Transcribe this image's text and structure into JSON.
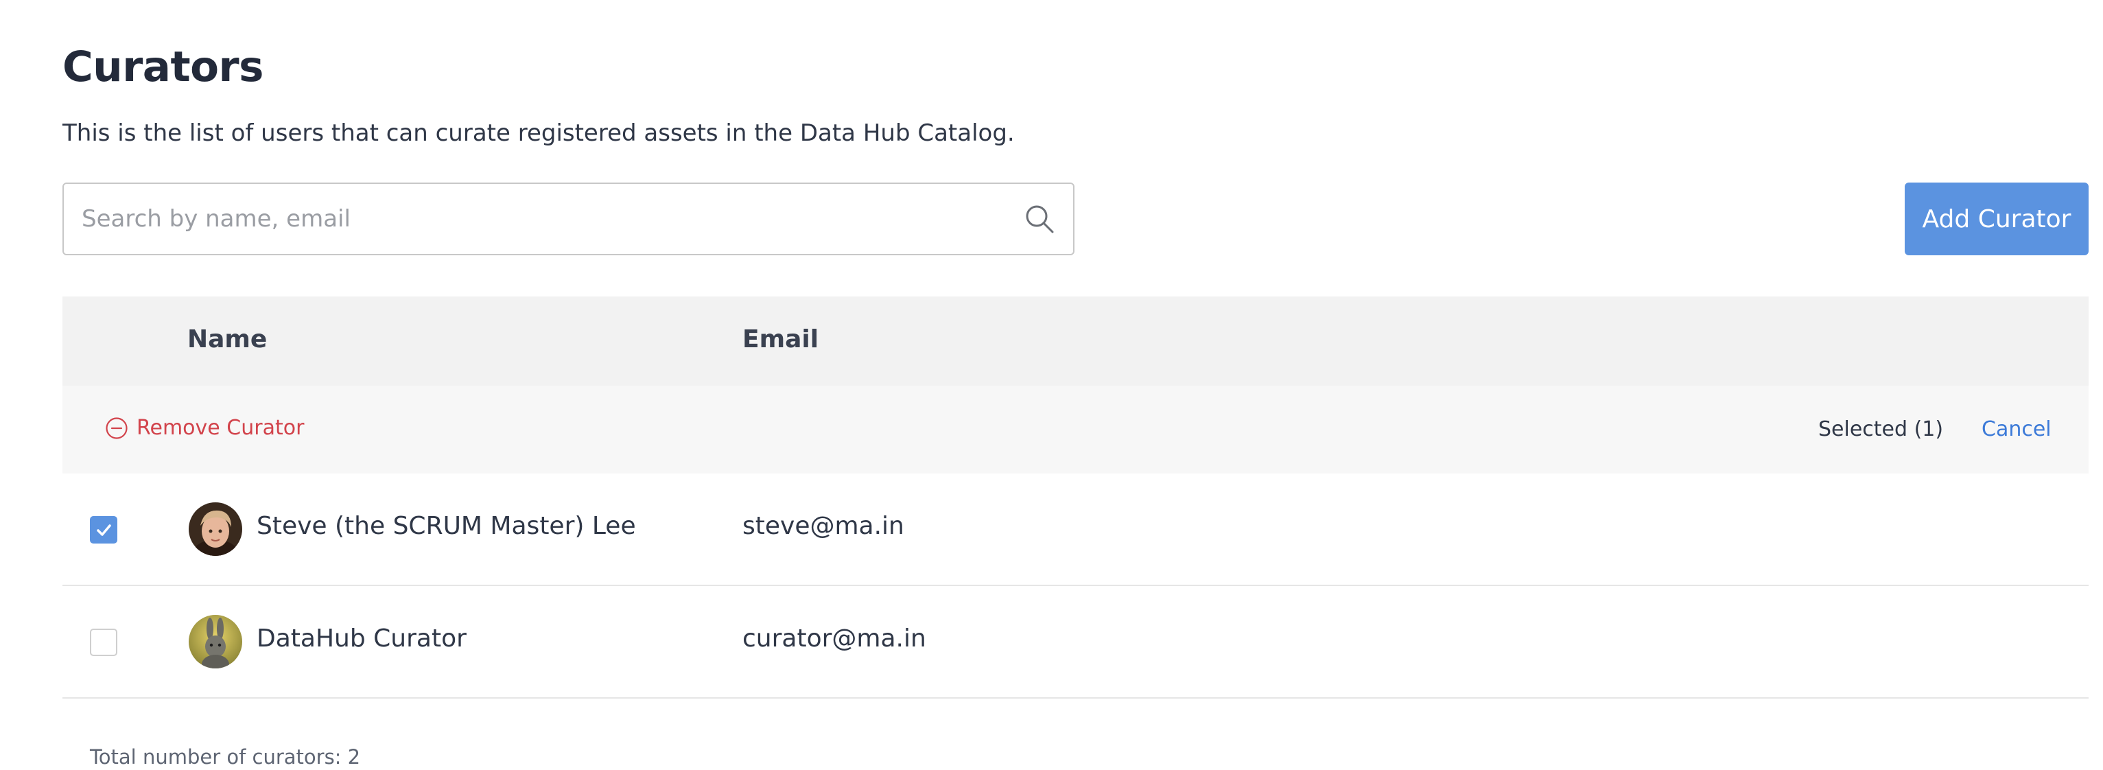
{
  "page": {
    "title": "Curators",
    "description": "This is the list of users that can curate registered assets in the Data Hub Catalog."
  },
  "search": {
    "placeholder": "Search by name, email",
    "value": "",
    "icon": "search-icon"
  },
  "actions": {
    "add_label": "Add Curator"
  },
  "table": {
    "columns": [
      "Name",
      "Email"
    ],
    "selection_bar": {
      "remove_label": "Remove Curator",
      "remove_icon": "minus-circle-icon",
      "selected_text": "Selected (1)",
      "cancel_label": "Cancel"
    },
    "rows": [
      {
        "name": "Steve (the SCRUM Master) Lee",
        "email": "steve@ma.in",
        "checked": true,
        "avatar": "avatar-photo"
      },
      {
        "name": "DataHub Curator",
        "email": "curator@ma.in",
        "checked": false,
        "avatar": "avatar-photo"
      }
    ]
  },
  "footer": {
    "total_text": "Total number of curators: 2"
  },
  "colors": {
    "accent": "#5b93e0",
    "danger": "#d2434b",
    "link": "#3c7ad8",
    "header_bg": "#f2f2f2"
  }
}
